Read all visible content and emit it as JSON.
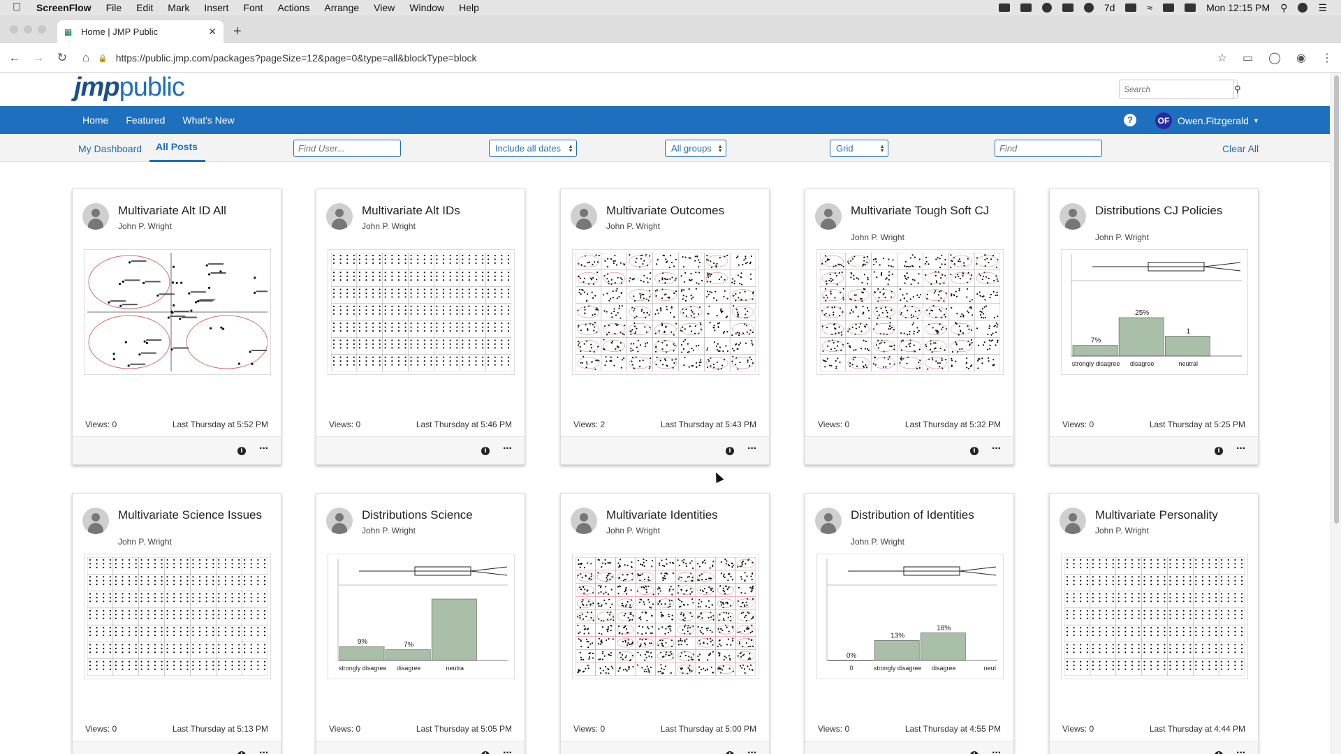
{
  "menubar": {
    "app": "ScreenFlow",
    "items": [
      "File",
      "Edit",
      "Mark",
      "Insert",
      "Font",
      "Actions",
      "Arrange",
      "View",
      "Window",
      "Help"
    ],
    "status_extra": "7d",
    "clock": "Mon 12:15 PM"
  },
  "browser": {
    "tab_title": "Home | JMP Public",
    "url": "https://public.jmp.com/packages?pageSize=12&page=0&type=all&blockType=block"
  },
  "site": {
    "logo_jmp": "jmp",
    "logo_public": "public",
    "search_placeholder": "Search",
    "nav": [
      "Home",
      "Featured",
      "What's New"
    ],
    "user_initials": "OF",
    "user_name": "Owen.Fitzgerald"
  },
  "filters": {
    "my_dashboard": "My Dashboard",
    "all_posts": "All Posts",
    "find_user_placeholder": "Find User...",
    "dates": "Include all dates",
    "groups": "All groups",
    "view": "Grid",
    "find_placeholder": "Find",
    "clear_all": "Clear All"
  },
  "colors": {
    "brand_blue": "#1e6fbd",
    "chart_green": "#a9bfa8",
    "chart_pink": "#d36a7a"
  },
  "cards": [
    {
      "title": "Multivariate Alt ID All",
      "author": "John P. Wright",
      "views": "Views: 0",
      "date": "Last Thursday at 5:52 PM",
      "thumb": "scatter-ellipses"
    },
    {
      "title": "Multivariate Alt IDs",
      "author": "John P. Wright",
      "views": "Views: 0",
      "date": "Last Thursday at 5:46 PM",
      "thumb": "matrix-dots"
    },
    {
      "title": "Multivariate Outcomes",
      "author": "John P. Wright",
      "views": "Views: 2",
      "date": "Last Thursday at 5:43 PM",
      "thumb": "matrix-scatter"
    },
    {
      "title": "Multivariate Tough Soft CJ",
      "author": "John P. Wright",
      "views": "Views: 0",
      "date": "Last Thursday at 5:32 PM",
      "thumb": "matrix-scatter"
    },
    {
      "title": "Distributions CJ Policies",
      "author": "John P. Wright",
      "views": "Views: 0",
      "date": "Last Thursday at 5:25 PM",
      "thumb": "histogram",
      "hist": {
        "labels": [
          "strongly disagree",
          "disagree",
          "neutral"
        ],
        "bars": [
          {
            "label": "7%",
            "value": 7
          },
          {
            "label": "25%",
            "value": 25
          },
          {
            "label": "1",
            "value": 13
          }
        ]
      }
    },
    {
      "title": "Multivariate Science Issues",
      "author": "John P. Wright",
      "views": "Views: 0",
      "date": "Last Thursday at 5:13 PM",
      "thumb": "matrix-dots"
    },
    {
      "title": "Distributions Science",
      "author": "John P. Wright",
      "views": "Views: 0",
      "date": "Last Thursday at 5:05 PM",
      "thumb": "histogram",
      "hist": {
        "labels": [
          "strongly disagree",
          "disagree",
          "neutra"
        ],
        "bars": [
          {
            "label": "9%",
            "value": 9
          },
          {
            "label": "7%",
            "value": 7
          },
          {
            "label": "",
            "value": 40
          }
        ]
      }
    },
    {
      "title": "Multivariate Identities",
      "author": "John P. Wright",
      "views": "Views: 0",
      "date": "Last Thursday at 5:00 PM",
      "thumb": "matrix-dense"
    },
    {
      "title": "Distribution of Identities",
      "author": "John P. Wright",
      "views": "Views: 0",
      "date": "Last Thursday at 4:55 PM",
      "thumb": "histogram",
      "hist": {
        "labels": [
          "0",
          "strongly disagree",
          "disagree",
          "neut"
        ],
        "bars": [
          {
            "label": "0%",
            "value": 0
          },
          {
            "label": "13%",
            "value": 13
          },
          {
            "label": "18%",
            "value": 18
          }
        ]
      }
    },
    {
      "title": "Multivariate Personality",
      "author": "John P. Wright",
      "views": "Views: 0",
      "date": "Last Thursday at 4:44 PM",
      "thumb": "matrix-dots"
    }
  ]
}
